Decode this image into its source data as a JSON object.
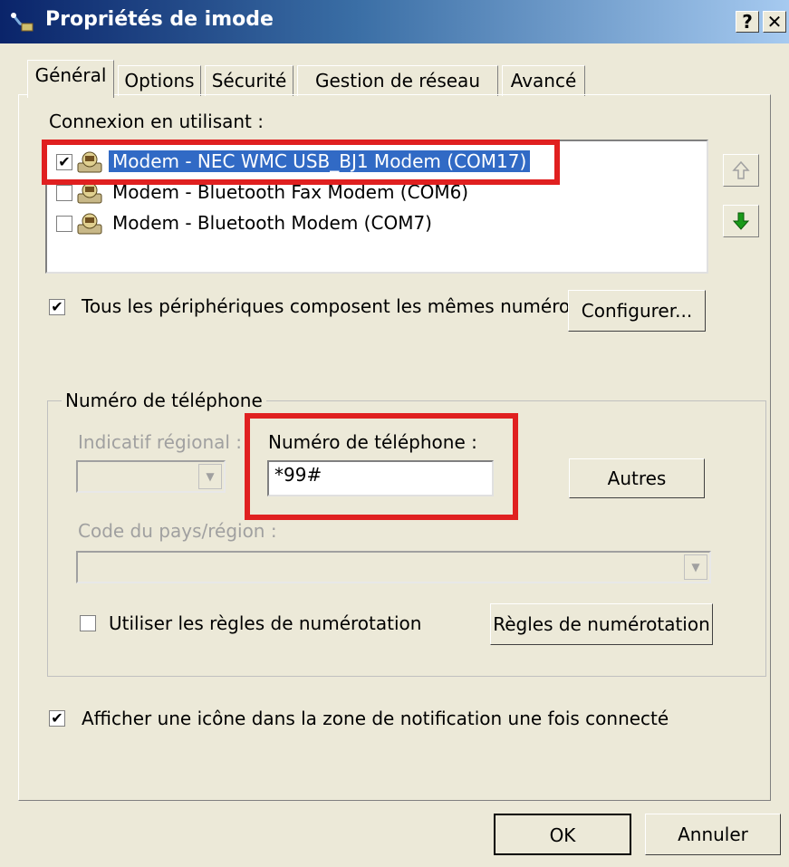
{
  "window": {
    "title": "Propriétés de imode",
    "help_label": "?",
    "close_label": "✕"
  },
  "tabs": [
    "Général",
    "Options",
    "Sécurité",
    "Gestion de réseau",
    "Avancé"
  ],
  "connection": {
    "label": "Connexion en utilisant :",
    "devices": [
      {
        "label": "Modem - NEC WMC USB_BJ1 Modem (COM17)",
        "checked": true,
        "selected": true
      },
      {
        "label": "Modem - Bluetooth Fax Modem (COM6)",
        "checked": false,
        "selected": false
      },
      {
        "label": "Modem - Bluetooth Modem (COM7)",
        "checked": false,
        "selected": false
      }
    ],
    "up_icon": "arrow-up-icon",
    "down_icon": "arrow-down-icon"
  },
  "same_numbers": {
    "label": "Tous les périphériques composent les mêmes numéros",
    "checked": true,
    "configure_label": "Configurer..."
  },
  "phone_group": {
    "title": "Numéro de téléphone",
    "area_code_label": "Indicatif régional :",
    "phone_label": "Numéro de téléphone :",
    "phone_value": "*99#",
    "others_label": "Autres",
    "country_label": "Code du pays/région :",
    "dialing_rules_label": "Utiliser les règles de numérotation",
    "dialing_rules_checked": false,
    "dialing_rules_button": "Règles de numérotation"
  },
  "notification": {
    "label": "Afficher une icône dans la zone de notification une fois connecté",
    "checked": true
  },
  "footer": {
    "ok_label": "OK",
    "cancel_label": "Annuler"
  },
  "colors": {
    "highlight": "#e02020",
    "selection": "#316ac5",
    "titlebar": "#0a246a"
  }
}
